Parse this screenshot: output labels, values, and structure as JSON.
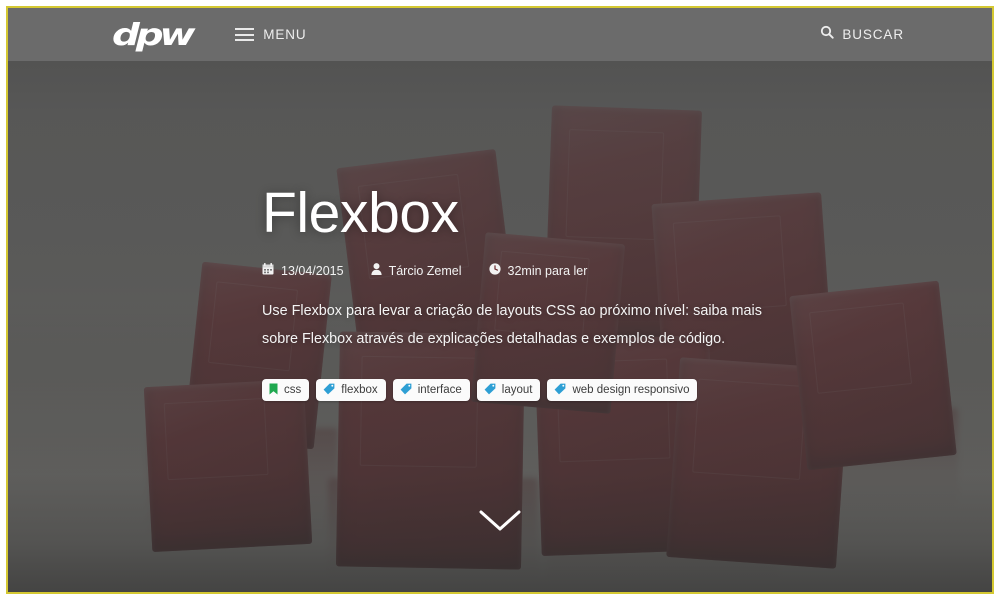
{
  "frame": {
    "border_color": "#d4c832",
    "outer_background": "#ffffff"
  },
  "topbar": {
    "background_color": "#6b6b6b",
    "logo_text": "dpw",
    "logo_icon": "dpw-logo",
    "menu_icon": "hamburger-icon",
    "menu_label": "MENU",
    "search_icon": "search-icon",
    "search_label": "BUSCAR"
  },
  "hero": {
    "overlay_color": "#484848",
    "background_image_description": "red translucent gelatin cubes",
    "cube_color": "#7d1118",
    "title": "Flexbox",
    "meta": [
      {
        "icon": "calendar-icon",
        "label": "13/04/2015"
      },
      {
        "icon": "user-icon",
        "label": "Tárcio Zemel"
      },
      {
        "icon": "clock-icon",
        "label": "32min para ler"
      }
    ],
    "description": "Use Flexbox para levar a criação de layouts CSS ao próximo nível: saiba mais sobre Flexbox através de explicações detalhadas e exemplos de código.",
    "tags": [
      {
        "icon": "bookmark-icon",
        "icon_color": "#1fa84f",
        "label": "css"
      },
      {
        "icon": "tag-icon",
        "icon_color": "#2e9fd4",
        "label": "flexbox"
      },
      {
        "icon": "tag-icon",
        "icon_color": "#2e9fd4",
        "label": "interface"
      },
      {
        "icon": "tag-icon",
        "icon_color": "#2e9fd4",
        "label": "layout"
      },
      {
        "icon": "tag-icon",
        "icon_color": "#2e9fd4",
        "label": "web design responsivo"
      }
    ],
    "scroll_icon": "chevron-down-icon"
  }
}
